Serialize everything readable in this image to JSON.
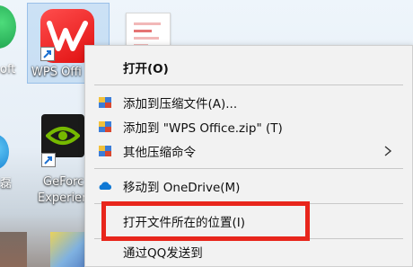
{
  "desktop": {
    "left_label_top": "oft",
    "left_label_mid": "磊",
    "wps_label": "WPS Offi",
    "geforce_label_1": "GeForc",
    "geforce_label_2": "Experien"
  },
  "menu": {
    "open": "打开(O)",
    "add_archive": "添加到压缩文件(A)...",
    "add_zip": "添加到 \"WPS Office.zip\" (T)",
    "other_compress": "其他压缩命令",
    "move_onedrive": "移动到 OneDrive(M)",
    "open_location": "打开文件所在的位置(I)",
    "send_qq": "通过QQ发送到"
  },
  "colors": {
    "highlight": "#e8261c",
    "wps_red": "#e01010",
    "onedrive": "#0f78d4"
  }
}
